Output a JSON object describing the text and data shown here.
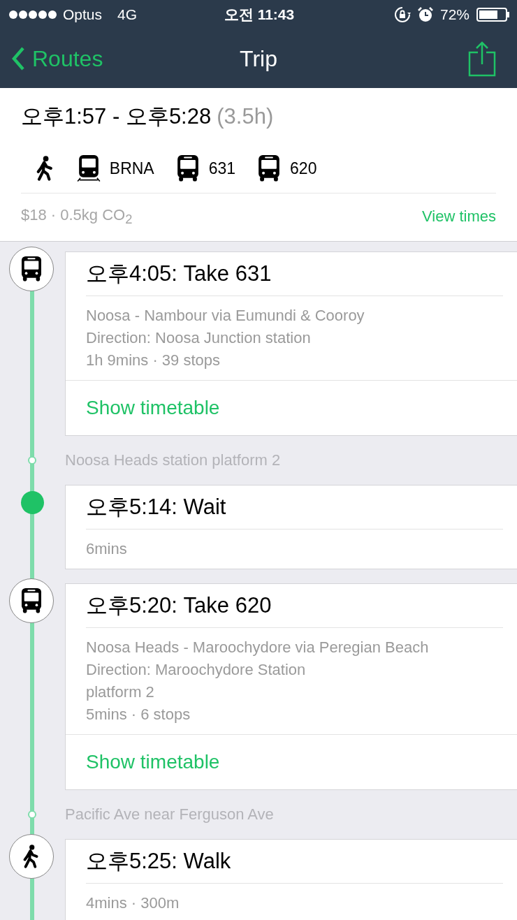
{
  "status_bar": {
    "carrier": "Optus",
    "network": "4G",
    "time": "오전 11:43",
    "battery": "72%"
  },
  "nav": {
    "back": "Routes",
    "title": "Trip"
  },
  "summary": {
    "time_range": "오후1:57 - 오후5:28",
    "duration": "(3.5h)",
    "legs": [
      {
        "kind": "walk"
      },
      {
        "kind": "train",
        "label": "BRNA"
      },
      {
        "kind": "bus",
        "label": "631"
      },
      {
        "kind": "bus",
        "label": "620"
      }
    ],
    "footer": "$18 · 0.5kg CO$_{2}$",
    "link": "View times"
  },
  "timeline": [
    {
      "kind": "bus",
      "title": "오후4:05: Take 631",
      "details": [
        "Noosa - Nambour via Eumundi & Cooroy",
        "Direction: Noosa Junction station",
        "1h 9mins · 39 stops"
      ],
      "action": "Show timetable"
    },
    {
      "kind": "stop",
      "name": "Noosa Heads station platform 2"
    },
    {
      "kind": "wait",
      "title": "오후5:14: Wait",
      "details": [
        "6mins"
      ]
    },
    {
      "kind": "bus",
      "title": "오후5:20: Take 620",
      "details": [
        "Noosa Heads - Maroochydore via Peregian Beach",
        "Direction: Maroochydore Station",
        "platform 2",
        "5mins · 6 stops"
      ],
      "action": "Show timetable"
    },
    {
      "kind": "stop",
      "name": "Pacific Ave near Ferguson Ave"
    },
    {
      "kind": "walk",
      "title": "오후5:25: Walk",
      "details": [
        "4mins · 300m"
      ]
    }
  ]
}
